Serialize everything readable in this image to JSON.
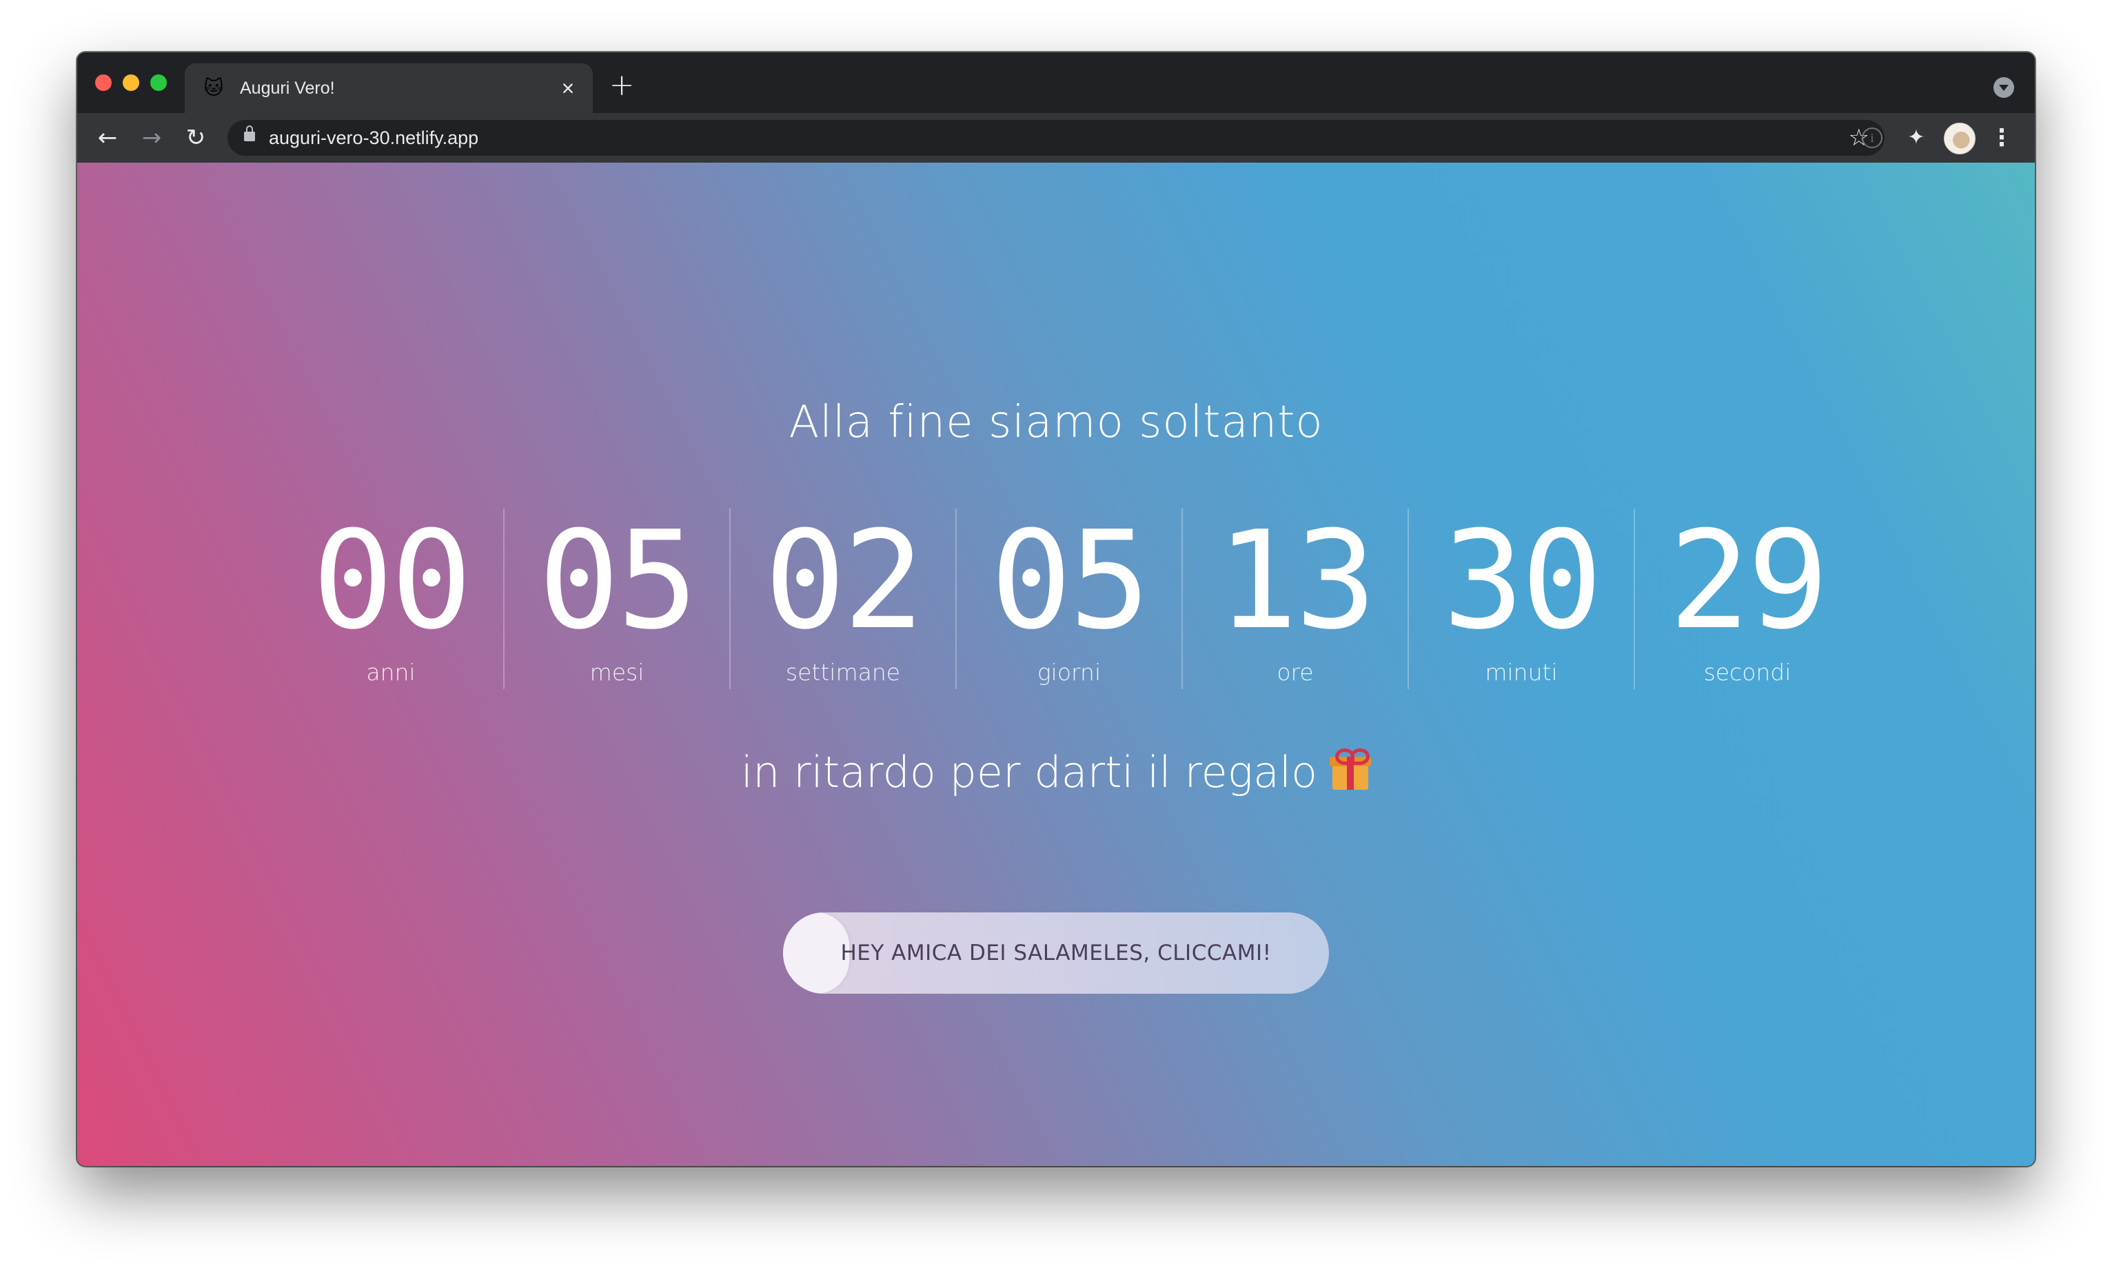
{
  "browser": {
    "tab": {
      "favicon": "🐱",
      "title": "Auguri Vero!",
      "close": "×"
    },
    "new_tab": "+",
    "nav": {
      "back": "←",
      "forward": "→",
      "reload": "↻"
    },
    "url": "auguri-vero-30.netlify.app",
    "star": "☆",
    "info": "i",
    "extensions": "✦",
    "menu": "⋮"
  },
  "page": {
    "headline": "Alla fine siamo soltanto",
    "countdown": [
      {
        "value": "00",
        "label": "anni"
      },
      {
        "value": "05",
        "label": "mesi"
      },
      {
        "value": "02",
        "label": "settimane"
      },
      {
        "value": "05",
        "label": "giorni"
      },
      {
        "value": "13",
        "label": "ore"
      },
      {
        "value": "30",
        "label": "minuti"
      },
      {
        "value": "29",
        "label": "secondi"
      }
    ],
    "subline": "in ritardo per darti il regalo",
    "cta_label": "HEY AMICA DEI SALAMELES, CLICCAMI!"
  },
  "colors": {
    "gradient_start": "#db4b7c",
    "gradient_mid": "#8580af",
    "gradient_end": "#4aa5d4",
    "text": "#ffffff"
  }
}
